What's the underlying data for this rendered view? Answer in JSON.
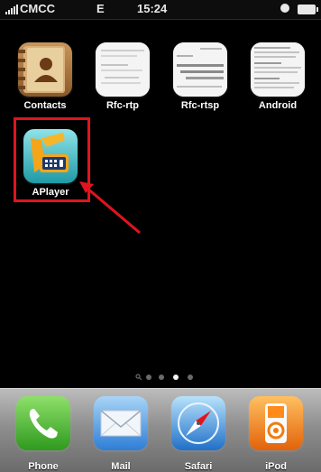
{
  "status_bar": {
    "carrier": "CMCC",
    "network": "E",
    "time": "15:24"
  },
  "home_apps": [
    {
      "label": "Contacts",
      "icon": "contacts-book-icon"
    },
    {
      "label": "Rfc-rtp",
      "icon": "document-thumbnail-icon"
    },
    {
      "label": "Rfc-rtsp",
      "icon": "document-thumbnail-icon"
    },
    {
      "label": "Android",
      "icon": "document-thumbnail-icon"
    },
    {
      "label": "APlayer",
      "icon": "aplayer-icon"
    }
  ],
  "page_indicator": {
    "pages": 3,
    "current": 2
  },
  "dock": [
    {
      "label": "Phone",
      "icon": "phone-icon"
    },
    {
      "label": "Mail",
      "icon": "mail-icon"
    },
    {
      "label": "Safari",
      "icon": "safari-compass-icon"
    },
    {
      "label": "iPod",
      "icon": "ipod-icon"
    }
  ],
  "colors": {
    "annotation": "#e0141e",
    "aplayer_bg": "#37b8c2",
    "phone_green": "#3fae2a",
    "ipod_orange": "#f07c10"
  }
}
